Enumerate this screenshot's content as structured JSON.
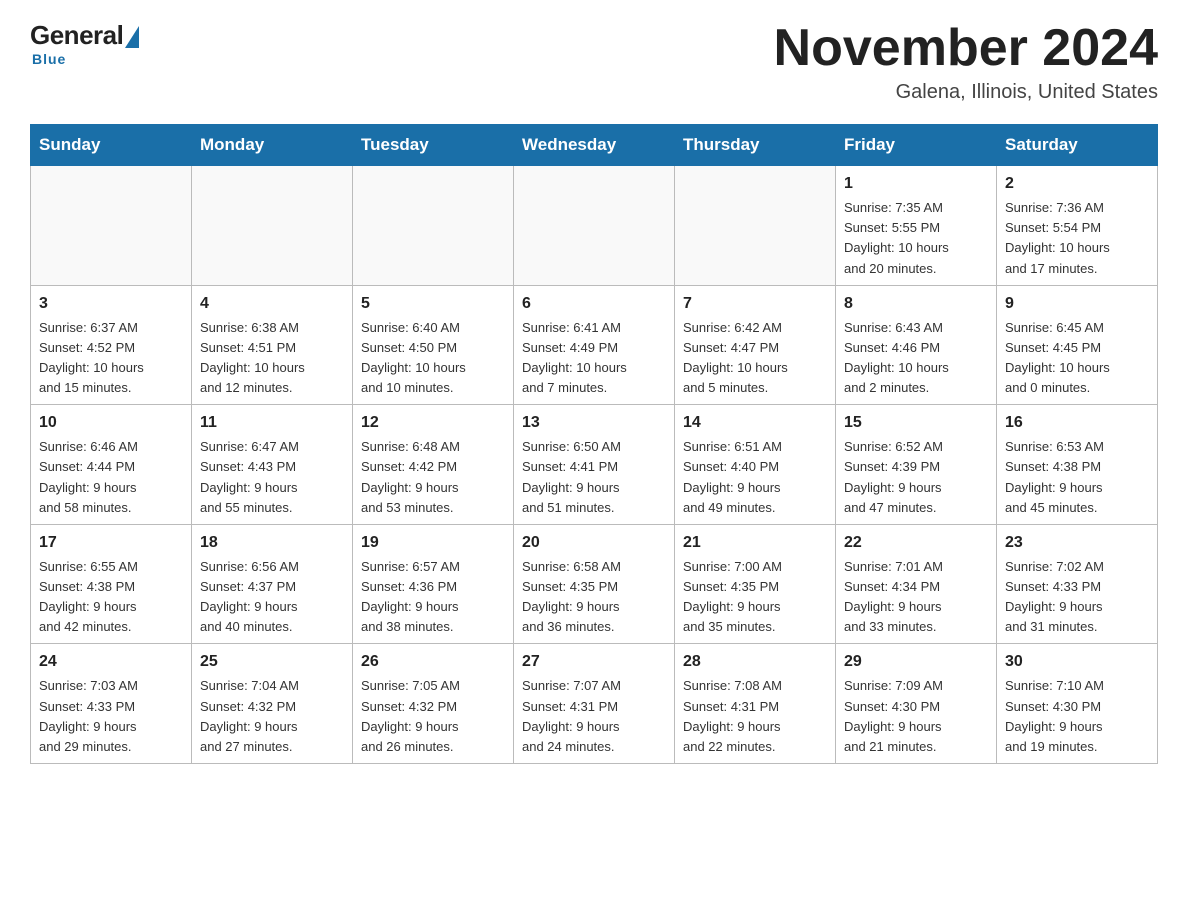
{
  "header": {
    "logo": {
      "general": "General",
      "blue": "Blue",
      "sub": "Blue"
    },
    "title": "November 2024",
    "location": "Galena, Illinois, United States"
  },
  "days_of_week": [
    "Sunday",
    "Monday",
    "Tuesday",
    "Wednesday",
    "Thursday",
    "Friday",
    "Saturday"
  ],
  "weeks": [
    [
      {
        "day": "",
        "info": ""
      },
      {
        "day": "",
        "info": ""
      },
      {
        "day": "",
        "info": ""
      },
      {
        "day": "",
        "info": ""
      },
      {
        "day": "",
        "info": ""
      },
      {
        "day": "1",
        "info": "Sunrise: 7:35 AM\nSunset: 5:55 PM\nDaylight: 10 hours\nand 20 minutes."
      },
      {
        "day": "2",
        "info": "Sunrise: 7:36 AM\nSunset: 5:54 PM\nDaylight: 10 hours\nand 17 minutes."
      }
    ],
    [
      {
        "day": "3",
        "info": "Sunrise: 6:37 AM\nSunset: 4:52 PM\nDaylight: 10 hours\nand 15 minutes."
      },
      {
        "day": "4",
        "info": "Sunrise: 6:38 AM\nSunset: 4:51 PM\nDaylight: 10 hours\nand 12 minutes."
      },
      {
        "day": "5",
        "info": "Sunrise: 6:40 AM\nSunset: 4:50 PM\nDaylight: 10 hours\nand 10 minutes."
      },
      {
        "day": "6",
        "info": "Sunrise: 6:41 AM\nSunset: 4:49 PM\nDaylight: 10 hours\nand 7 minutes."
      },
      {
        "day": "7",
        "info": "Sunrise: 6:42 AM\nSunset: 4:47 PM\nDaylight: 10 hours\nand 5 minutes."
      },
      {
        "day": "8",
        "info": "Sunrise: 6:43 AM\nSunset: 4:46 PM\nDaylight: 10 hours\nand 2 minutes."
      },
      {
        "day": "9",
        "info": "Sunrise: 6:45 AM\nSunset: 4:45 PM\nDaylight: 10 hours\nand 0 minutes."
      }
    ],
    [
      {
        "day": "10",
        "info": "Sunrise: 6:46 AM\nSunset: 4:44 PM\nDaylight: 9 hours\nand 58 minutes."
      },
      {
        "day": "11",
        "info": "Sunrise: 6:47 AM\nSunset: 4:43 PM\nDaylight: 9 hours\nand 55 minutes."
      },
      {
        "day": "12",
        "info": "Sunrise: 6:48 AM\nSunset: 4:42 PM\nDaylight: 9 hours\nand 53 minutes."
      },
      {
        "day": "13",
        "info": "Sunrise: 6:50 AM\nSunset: 4:41 PM\nDaylight: 9 hours\nand 51 minutes."
      },
      {
        "day": "14",
        "info": "Sunrise: 6:51 AM\nSunset: 4:40 PM\nDaylight: 9 hours\nand 49 minutes."
      },
      {
        "day": "15",
        "info": "Sunrise: 6:52 AM\nSunset: 4:39 PM\nDaylight: 9 hours\nand 47 minutes."
      },
      {
        "day": "16",
        "info": "Sunrise: 6:53 AM\nSunset: 4:38 PM\nDaylight: 9 hours\nand 45 minutes."
      }
    ],
    [
      {
        "day": "17",
        "info": "Sunrise: 6:55 AM\nSunset: 4:38 PM\nDaylight: 9 hours\nand 42 minutes."
      },
      {
        "day": "18",
        "info": "Sunrise: 6:56 AM\nSunset: 4:37 PM\nDaylight: 9 hours\nand 40 minutes."
      },
      {
        "day": "19",
        "info": "Sunrise: 6:57 AM\nSunset: 4:36 PM\nDaylight: 9 hours\nand 38 minutes."
      },
      {
        "day": "20",
        "info": "Sunrise: 6:58 AM\nSunset: 4:35 PM\nDaylight: 9 hours\nand 36 minutes."
      },
      {
        "day": "21",
        "info": "Sunrise: 7:00 AM\nSunset: 4:35 PM\nDaylight: 9 hours\nand 35 minutes."
      },
      {
        "day": "22",
        "info": "Sunrise: 7:01 AM\nSunset: 4:34 PM\nDaylight: 9 hours\nand 33 minutes."
      },
      {
        "day": "23",
        "info": "Sunrise: 7:02 AM\nSunset: 4:33 PM\nDaylight: 9 hours\nand 31 minutes."
      }
    ],
    [
      {
        "day": "24",
        "info": "Sunrise: 7:03 AM\nSunset: 4:33 PM\nDaylight: 9 hours\nand 29 minutes."
      },
      {
        "day": "25",
        "info": "Sunrise: 7:04 AM\nSunset: 4:32 PM\nDaylight: 9 hours\nand 27 minutes."
      },
      {
        "day": "26",
        "info": "Sunrise: 7:05 AM\nSunset: 4:32 PM\nDaylight: 9 hours\nand 26 minutes."
      },
      {
        "day": "27",
        "info": "Sunrise: 7:07 AM\nSunset: 4:31 PM\nDaylight: 9 hours\nand 24 minutes."
      },
      {
        "day": "28",
        "info": "Sunrise: 7:08 AM\nSunset: 4:31 PM\nDaylight: 9 hours\nand 22 minutes."
      },
      {
        "day": "29",
        "info": "Sunrise: 7:09 AM\nSunset: 4:30 PM\nDaylight: 9 hours\nand 21 minutes."
      },
      {
        "day": "30",
        "info": "Sunrise: 7:10 AM\nSunset: 4:30 PM\nDaylight: 9 hours\nand 19 minutes."
      }
    ]
  ]
}
